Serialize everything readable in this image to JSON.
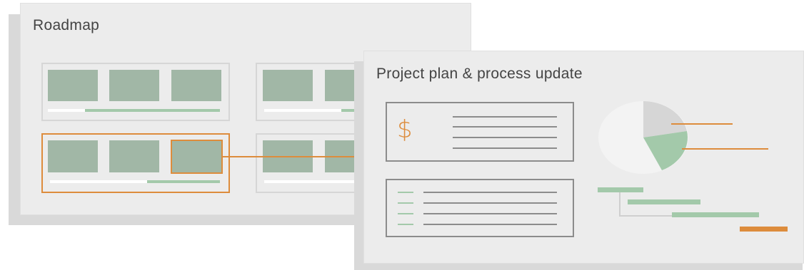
{
  "roadmap": {
    "title": "Roadmap"
  },
  "project": {
    "title": "Project plan & process update"
  },
  "icons": {
    "currency": "$"
  },
  "colors": {
    "accent": "#dd8c3c",
    "tile": "#a1b7a6",
    "progress": "#a3c9aa",
    "card": "#ececec"
  }
}
